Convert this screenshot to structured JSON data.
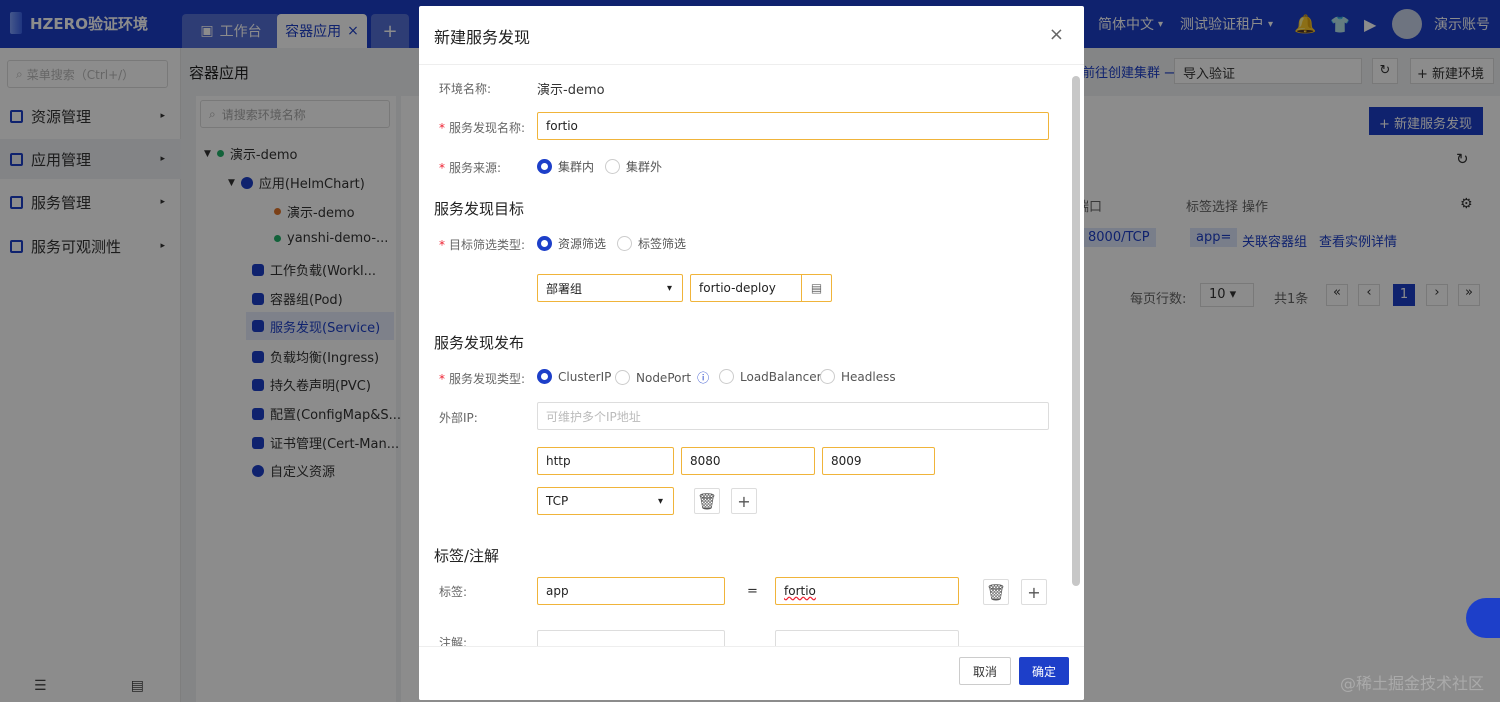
{
  "app": {
    "title": "HZERO验证环境"
  },
  "tabs": [
    {
      "label": "工作台"
    },
    {
      "label": "容器应用",
      "close": "×"
    },
    {
      "label": "+"
    }
  ],
  "header": {
    "language": "简体中文",
    "tenant": "测试验证租户",
    "account": "演示账号"
  },
  "sidebar": {
    "search_placeholder": "菜单搜索（Ctrl+/）",
    "items": [
      {
        "label": "资源管理"
      },
      {
        "label": "应用管理"
      },
      {
        "label": "服务管理"
      },
      {
        "label": "服务可观测性"
      }
    ]
  },
  "page": {
    "title": "容器应用"
  },
  "tree": {
    "search_placeholder": "请搜索环境名称",
    "nodes": [
      {
        "label": "演示-demo"
      },
      {
        "label": "应用(HelmChart)"
      },
      {
        "label": "演示-demo"
      },
      {
        "label": "yanshi-demo-..."
      },
      {
        "label": "工作负载(Workl..."
      },
      {
        "label": "容器组(Pod)"
      },
      {
        "label": "服务发现(Service)"
      },
      {
        "label": "负载均衡(Ingress)"
      },
      {
        "label": "持久卷声明(PVC)"
      },
      {
        "label": "配置(ConfigMap&S..."
      },
      {
        "label": "证书管理(Cert-Man..."
      },
      {
        "label": "自定义资源"
      }
    ]
  },
  "background": {
    "create_cluster_link": "前往创建集群",
    "import_validate": "导入验证",
    "new_env_button": "新建环境",
    "new_service_button": "新建服务发现",
    "col_port": "端口",
    "col_labels": "标签选择",
    "col_actions": "操作",
    "port_value": "8000/TCP",
    "label_value": "app=",
    "action_link_1": "关联容器组",
    "action_link_2": "查看实例详情",
    "page_size_label": "每页行数:",
    "page_size": "10",
    "total": "共1条",
    "current_page": "1"
  },
  "modal": {
    "title": "新建服务发现",
    "env_label": "环境名称:",
    "env_value": "演示-demo",
    "name_label": "服务发现名称:",
    "name_value": "fortio",
    "source_label": "服务来源:",
    "source_options": [
      "集群内",
      "集群外"
    ],
    "target_section": "服务发现目标",
    "filter_type_label": "目标筛选类型:",
    "filter_options": [
      "资源筛选",
      "标签筛选"
    ],
    "resource_kind": "部署组",
    "resource_name": "fortio-deploy",
    "publish_section": "服务发现发布",
    "svc_type_label": "服务发现类型:",
    "svc_types": [
      "ClusterIP",
      "NodePort",
      "LoadBalancer",
      "Headless"
    ],
    "external_ip_label": "外部IP:",
    "external_ip_placeholder": "可维护多个IP地址",
    "port_name": "http",
    "port": "8080",
    "target_port": "8009",
    "protocol": "TCP",
    "labels_section": "标签/注解",
    "label_label": "标签:",
    "label_key": "app",
    "label_eq": "=",
    "label_val": "fortio",
    "annotation_label": "注解:",
    "cancel": "取消",
    "ok": "确定"
  },
  "watermark": "@稀土掘金技术社区"
}
